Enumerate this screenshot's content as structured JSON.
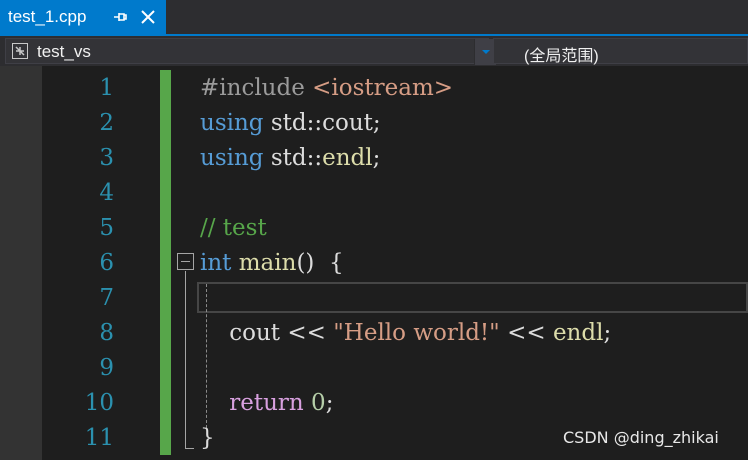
{
  "tabs": [
    {
      "label": "test_1.cpp",
      "active": true,
      "pin_icon": "pin-icon",
      "close_icon": "close-icon"
    }
  ],
  "navbar": {
    "project": {
      "label": "test_vs",
      "icon": "project-icon"
    },
    "scope": {
      "label": "(全局范围)"
    }
  },
  "editor": {
    "line_numbers": [
      "1",
      "2",
      "3",
      "4",
      "5",
      "6",
      "7",
      "8",
      "9",
      "10",
      "11"
    ],
    "lines": [
      [
        {
          "t": "#include ",
          "c": "pre"
        },
        {
          "t": "<iostream>",
          "c": "str"
        }
      ],
      [
        {
          "t": "using",
          "c": "kw"
        },
        {
          "t": " std::cout;",
          "c": "pl"
        }
      ],
      [
        {
          "t": "using",
          "c": "kw"
        },
        {
          "t": " std::",
          "c": "pl"
        },
        {
          "t": "endl",
          "c": "fn"
        },
        {
          "t": ";",
          "c": "pl"
        }
      ],
      [],
      [
        {
          "t": "// test",
          "c": "cm"
        }
      ],
      [
        {
          "t": "int",
          "c": "kw"
        },
        {
          "t": " ",
          "c": "pl"
        },
        {
          "t": "main",
          "c": "fn"
        },
        {
          "t": "()  {",
          "c": "pl"
        }
      ],
      [],
      [
        {
          "t": "    cout << ",
          "c": "pl"
        },
        {
          "t": "\"Hello world!\"",
          "c": "str"
        },
        {
          "t": " << ",
          "c": "pl"
        },
        {
          "t": "endl",
          "c": "fn"
        },
        {
          "t": ";",
          "c": "pl"
        }
      ],
      [],
      [
        {
          "t": "    ",
          "c": "pl"
        },
        {
          "t": "return",
          "c": "ctl"
        },
        {
          "t": " ",
          "c": "pl"
        },
        {
          "t": "0",
          "c": "num"
        },
        {
          "t": ";",
          "c": "pl"
        }
      ],
      [
        {
          "t": "}",
          "c": "pl"
        }
      ]
    ]
  },
  "colors": {
    "accent": "#007acc",
    "line_number": "#2b91af",
    "change_bar": "#57a64a",
    "pre": "#9b9b9b",
    "str": "#d69d85",
    "kw": "#569cd6",
    "fn": "#dcdcaa",
    "cm": "#57a64a",
    "ctl": "#d8a0df",
    "num": "#b5cea8",
    "pl": "#dcdcdc"
  },
  "watermark": "CSDN @ding_zhikai"
}
